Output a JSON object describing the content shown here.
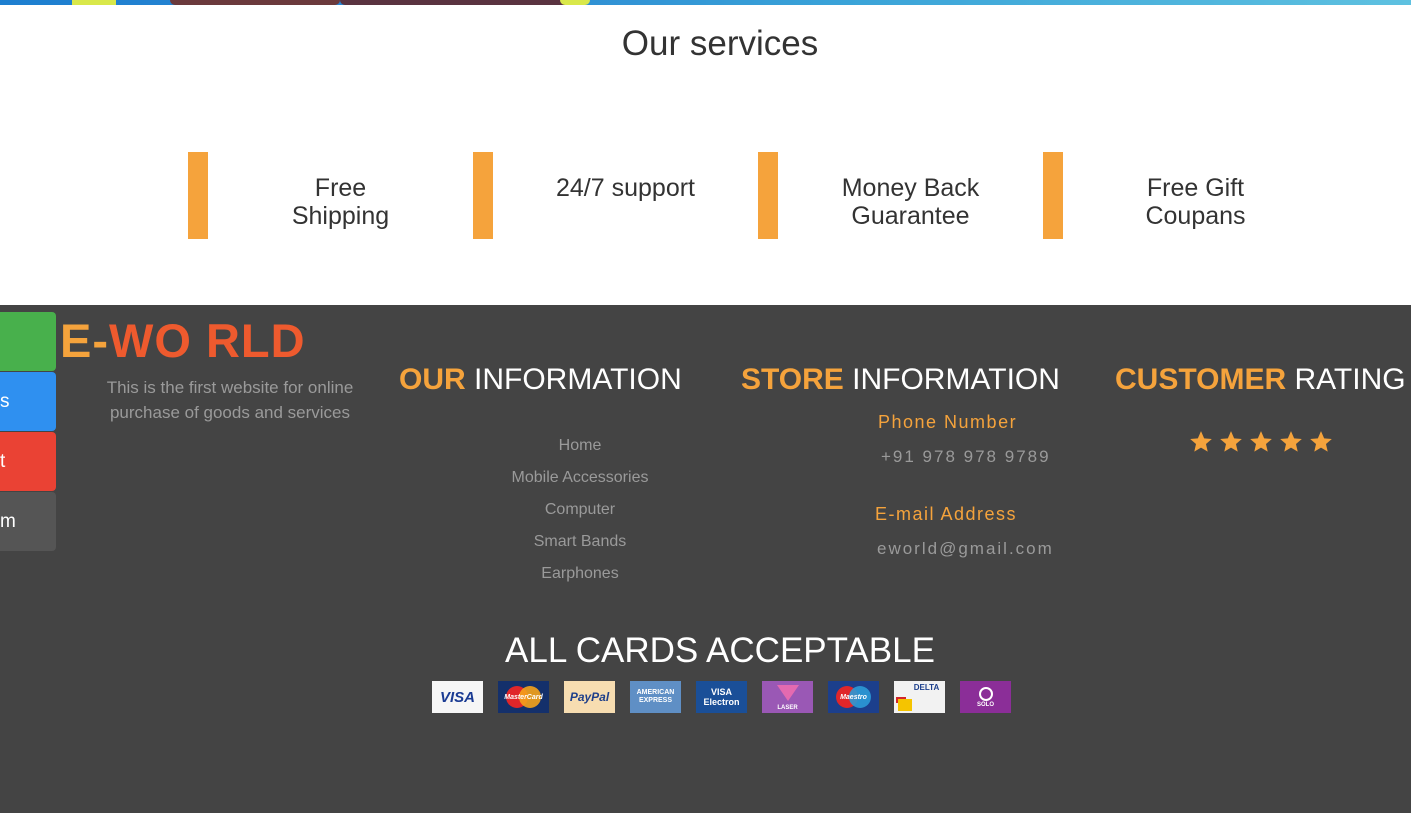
{
  "services": {
    "title": "Our services",
    "items": [
      {
        "line1": "Free",
        "line2": "Shipping"
      },
      {
        "line1": "24/7 support",
        "line2": ""
      },
      {
        "line1": "Money Back",
        "line2": "Guarantee"
      },
      {
        "line1": "Free Gift",
        "line2": "Coupans"
      }
    ]
  },
  "footer": {
    "brand_prefix": "E-",
    "brand_rest": "WO RLD",
    "brand_desc": "This is the first website for online purchase of goods and services",
    "our_info": {
      "accent": "OUR",
      "rest": " INFORMATION",
      "links": [
        "Home",
        "Mobile Accessories",
        "Computer",
        "Smart Bands",
        "Earphones"
      ]
    },
    "store_info": {
      "accent": "STORE",
      "rest": " INFORMATION",
      "phone_label": "Phone Number",
      "phone_value": "+91 978 978 9789",
      "email_label": "E-mail Address",
      "email_value": "eworld@gmail.com"
    },
    "rating": {
      "accent": "CUSTOMER",
      "rest": " RATING",
      "stars": 5,
      "max": 5
    },
    "cards_title": "ALL CARDS ACCEPTABLE",
    "cards": [
      "VISA",
      "MasterCard",
      "PayPal",
      "AMERICAN EXPRESS",
      "VISA Electron",
      "LASER",
      "Maestro",
      "DELTA",
      "SOLO"
    ]
  },
  "side_tabs": [
    {
      "label": "",
      "color": "#48b04c"
    },
    {
      "label": "s",
      "color": "#2f90f0"
    },
    {
      "label": "t",
      "color": "#ea4234"
    },
    {
      "label": "m",
      "color": "#555555"
    }
  ],
  "colors": {
    "accent": "#f5a33c",
    "brand": "#ee5a2e",
    "footer_bg": "#444444"
  }
}
